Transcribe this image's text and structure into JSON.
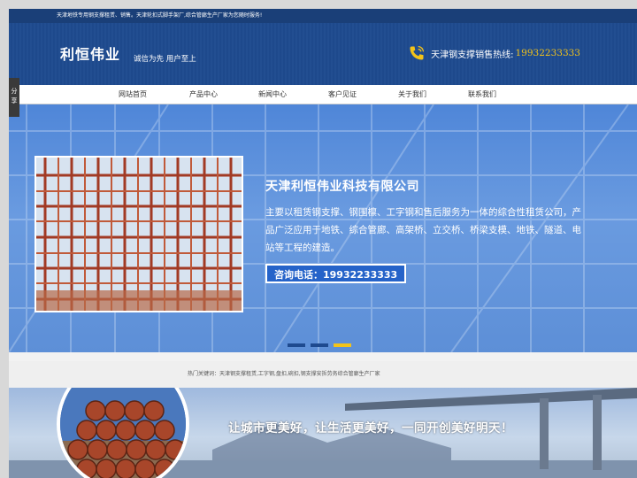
{
  "topbar": {
    "text": "天津地铁专用钢支撑租赁、销售。天津轮扣式脚手架厂,综合管廊生产厂家为您随时服务!"
  },
  "header": {
    "logo": "利恒伟业",
    "slogan": "诚信为先 用户至上",
    "hotline_label": "天津钢支撑销售热线:",
    "hotline_number": "19932233333"
  },
  "share": {
    "label_1": "分",
    "label_2": "享"
  },
  "nav": {
    "items": [
      {
        "label": "网站首页"
      },
      {
        "label": "产品中心"
      },
      {
        "label": "新闻中心"
      },
      {
        "label": "客户见证"
      },
      {
        "label": "关于我们"
      },
      {
        "label": "联系我们"
      }
    ]
  },
  "hero": {
    "company": "天津利恒伟业科技有限公司",
    "description": "主要以租赁钢支撑、钢围檩、工字钢和售后服务为一体的综合性租赁公司，产品广泛应用于地铁、综合管廊、高架桥、立交桥、桥梁支模、地铁、隧道、电站等工程的建造。",
    "consult": "咨询电话：19932233333",
    "slides_total": 3,
    "slide_active": 3
  },
  "keywords": {
    "text": "热门关键词：天津钢支撑租赁,工字钢,盘扣,碗扣,钢支撑安拆劳务综合管廊生产厂家"
  },
  "banner": {
    "text": "让城市更美好，让生活更美好，一同开创美好明天！"
  },
  "colors": {
    "primary": "#1e4a8f",
    "accent": "#f3c319",
    "button": "#2563c9"
  },
  "icons": {
    "hotline": "phone-icon"
  }
}
